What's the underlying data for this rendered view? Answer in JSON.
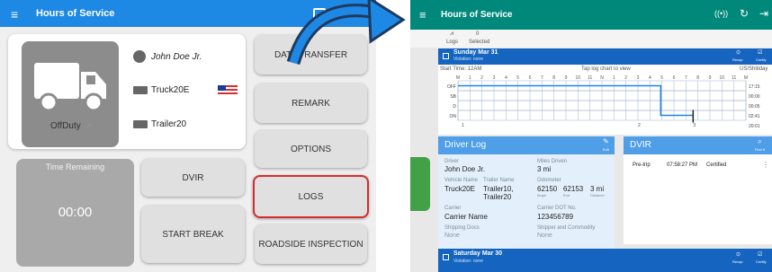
{
  "left": {
    "app_title": "Hours of Service",
    "driver_name": "John Doe Jr.",
    "truck": "Truck20E",
    "trailer": "Trailer20",
    "status": "OffDuty",
    "status_chevron": ">",
    "time_remaining_label": "Time Remaining",
    "time_remaining_value": "00:00",
    "buttons": {
      "data_transfer": "DATA TRANSFER",
      "remark": "REMARK",
      "options": "OPTIONS",
      "dvir": "DVIR",
      "logs": "LOGS",
      "start_break": "START BREAK",
      "roadside_inspection": "ROADSIDE INSPECTION"
    },
    "colors": {
      "appbar": "#1e88e5",
      "logs_border": "#d32f2f"
    }
  },
  "right": {
    "app_title": "Hours of Service",
    "toolbar": {
      "logs": "Logs",
      "count": "0",
      "selected": "Selected"
    },
    "day1": {
      "date": "Sunday Mar 31",
      "violation": "Violation: none",
      "recap": "Recap",
      "certify": "Certify"
    },
    "start_time": "Start Time: 12AM",
    "tap_hint": "Tap log chart to view",
    "timezone": "US/Shitiday",
    "status_rows": [
      "OFF",
      "SB",
      "D",
      "ON"
    ],
    "hour_labels": [
      "M",
      "1",
      "2",
      "3",
      "4",
      "5",
      "6",
      "7",
      "8",
      "9",
      "10",
      "11",
      "N",
      "1",
      "2",
      "3",
      "4",
      "5",
      "6",
      "7",
      "8",
      "9",
      "10",
      "11",
      "M"
    ],
    "totals": [
      "17:15",
      "00:00",
      "00:05",
      "02:41",
      "20:01"
    ],
    "chart_marks": [
      "1",
      "2",
      "3"
    ],
    "driver_log": {
      "title": "Driver Log",
      "edit": "Edit",
      "driver_label": "Driver",
      "driver": "John Doe Jr.",
      "miles_label": "Miles Driven",
      "miles": "3 mi",
      "vehicle_label": "Vehicle Name",
      "vehicle": "Truck20E",
      "trailer_label": "Trailer Name",
      "trailer": "Trailer10, Trailer20",
      "odometer_label": "Odometer",
      "odo_begin": "62150",
      "odo_begin_label": "Begin",
      "odo_end": "62153",
      "odo_end_label": "End",
      "odo_distance": "3 mi",
      "odo_distance_label": "Distance",
      "carrier_label": "Carrier",
      "carrier": "Carrier Name",
      "dot_label": "Carrier DOT No.",
      "dot": "123456789",
      "shipping_label": "Shipping Docs",
      "shipping": "None",
      "shipper_label": "Shipper and Commodity",
      "shipper": "None"
    },
    "dvir": {
      "title": "DVIR",
      "findit": "Find it",
      "type": "Pre-trip",
      "time": "07:58:27 PM",
      "status": "Certified"
    },
    "day2": {
      "date": "Saturday Mar 30",
      "violation": "Violation: none",
      "recap": "Recap",
      "certify": "Certify"
    },
    "colors": {
      "appbar": "#00897b",
      "dayhead": "#1565c0",
      "graph_line": "#1e88e5"
    }
  }
}
